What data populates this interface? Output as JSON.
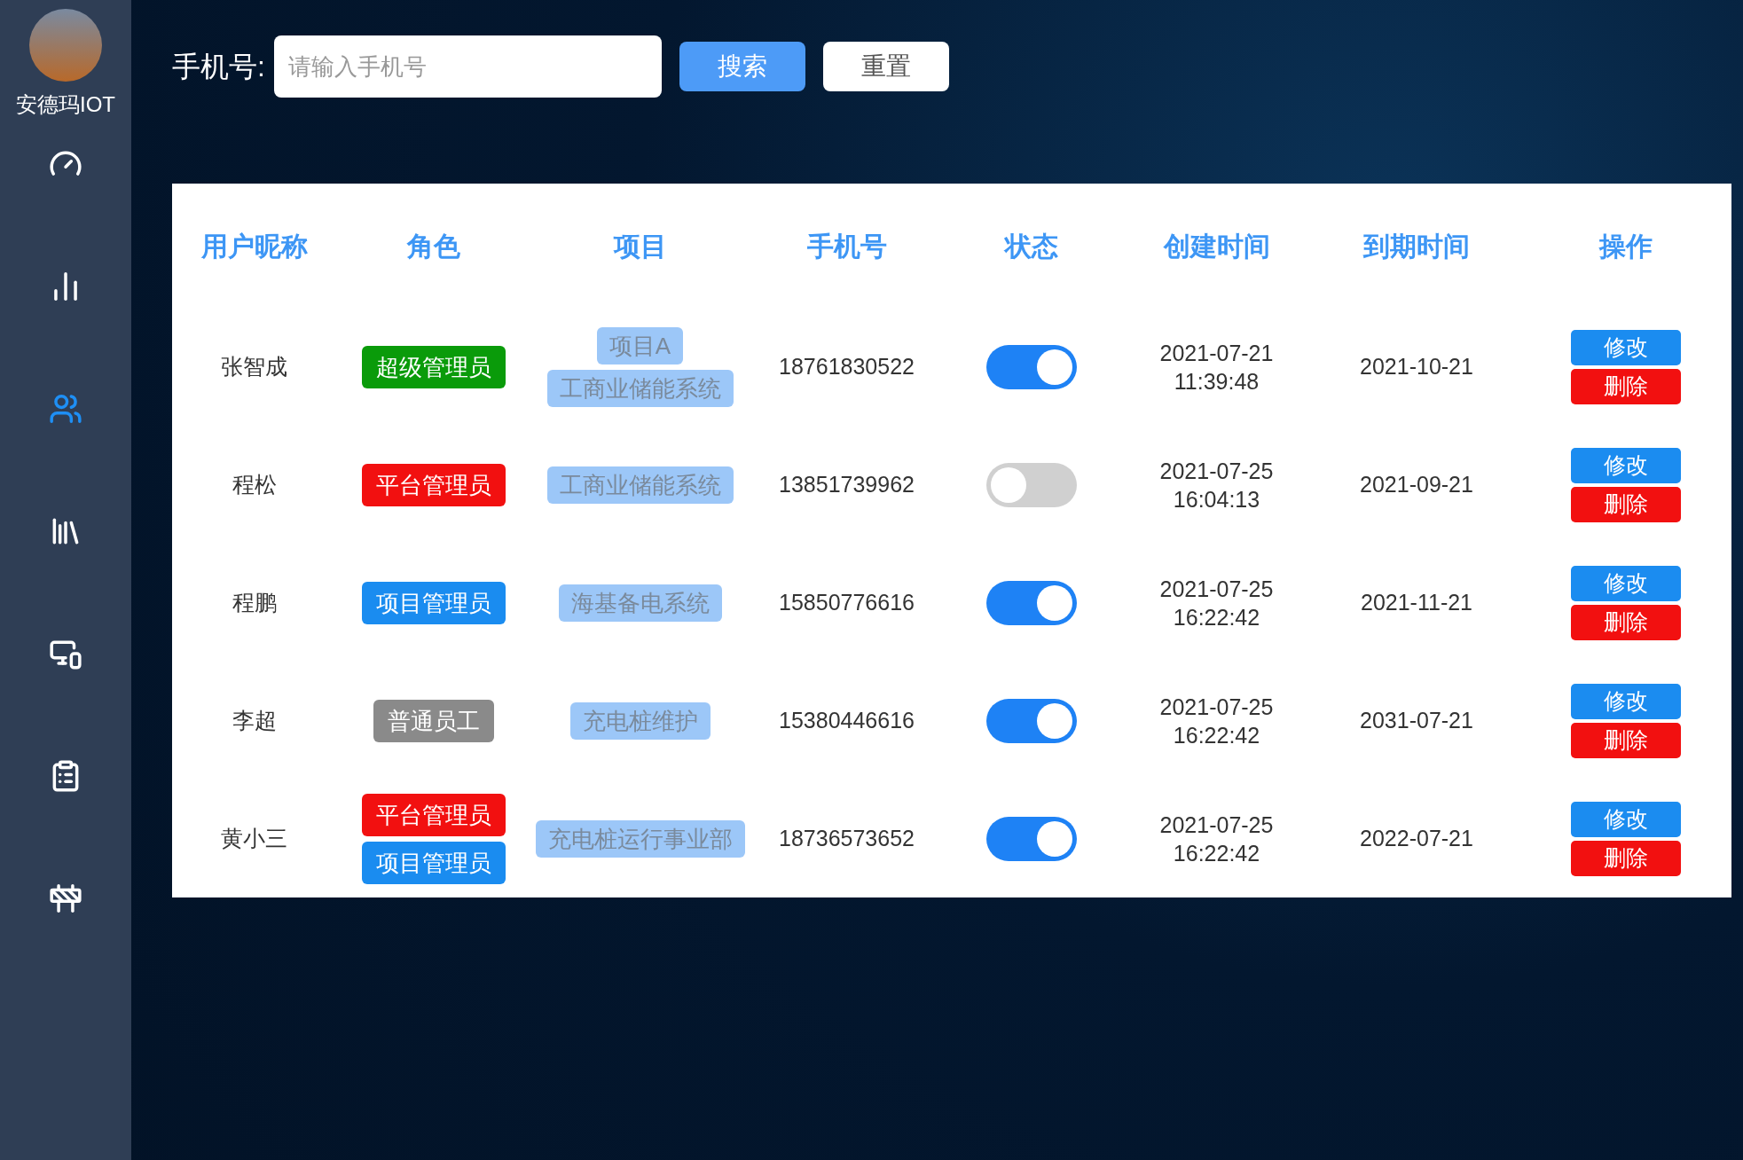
{
  "sidebar": {
    "brand": "安德玛IOT",
    "items": [
      {
        "selected": false
      },
      {
        "selected": false
      },
      {
        "selected": true
      },
      {
        "selected": false
      },
      {
        "selected": false
      },
      {
        "selected": false
      },
      {
        "selected": false
      }
    ]
  },
  "search": {
    "label": "手机号:",
    "placeholder": "请输入手机号",
    "buttons": [
      "搜索",
      "重置"
    ]
  },
  "table": {
    "columns": [
      "用户昵称",
      "角色",
      "项目",
      "手机号",
      "状态",
      "创建时间",
      "到期时间",
      "操作"
    ],
    "rows": [
      {
        "name": "张智成",
        "roles": [
          {
            "label": "超级管理员",
            "color": "#0a9b0a"
          }
        ],
        "projects": [
          "项目A",
          "工商业储能系统"
        ],
        "phone": "18761830522",
        "on": true,
        "created": "2021-07-21 11:39:48",
        "expires": "2021-10-21",
        "actions": [
          "修改",
          "删除"
        ]
      },
      {
        "name": "程松",
        "roles": [
          {
            "label": "平台管理员",
            "color": "#f21010"
          }
        ],
        "projects": [
          "工商业储能系统"
        ],
        "phone": "13851739962",
        "on": false,
        "created": "2021-07-25 16:04:13",
        "expires": "2021-09-21",
        "actions": [
          "修改",
          "删除"
        ]
      },
      {
        "name": "程鹏",
        "roles": [
          {
            "label": "项目管理员",
            "color": "#1a8cf0"
          }
        ],
        "projects": [
          "海基备电系统"
        ],
        "phone": "15850776616",
        "on": true,
        "created": "2021-07-25 16:22:42",
        "expires": "2021-11-21",
        "actions": [
          "修改",
          "删除"
        ]
      },
      {
        "name": "李超",
        "roles": [
          {
            "label": "普通员工",
            "color": "#8a8a8a"
          }
        ],
        "projects": [
          "充电桩维护"
        ],
        "phone": "15380446616",
        "on": true,
        "created": "2021-07-25 16:22:42",
        "expires": "2031-07-21",
        "actions": [
          "修改",
          "删除"
        ]
      },
      {
        "name": "黄小三",
        "roles": [
          {
            "label": "平台管理员",
            "color": "#f21010"
          },
          {
            "label": "项目管理员",
            "color": "#1a8cf0"
          }
        ],
        "projects": [
          "充电桩运行事业部"
        ],
        "phone": "18736573652",
        "on": true,
        "created": "2021-07-25 16:22:42",
        "expires": "2022-07-21",
        "actions": [
          "修改",
          "删除"
        ]
      }
    ]
  }
}
